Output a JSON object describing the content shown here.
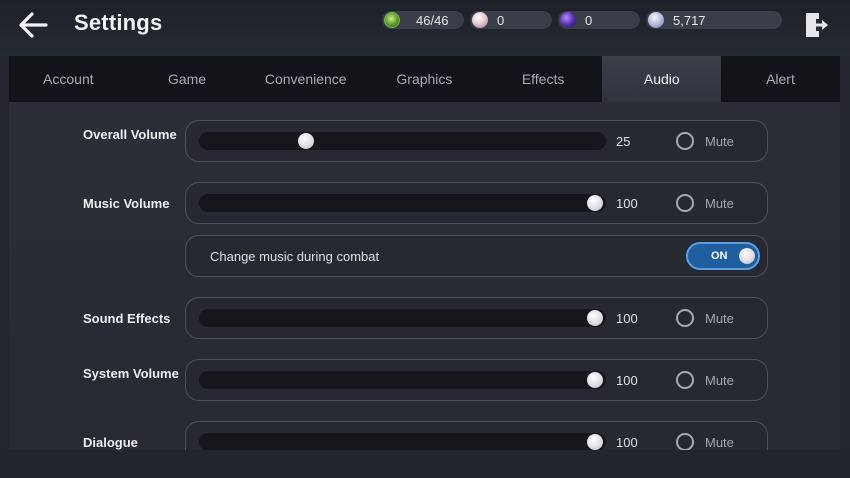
{
  "header": {
    "title": "Settings",
    "currencies": {
      "energy": "46/46",
      "pearl": "0",
      "orb": "0",
      "coin": "5,717"
    }
  },
  "tabs": [
    "Account",
    "Game",
    "Convenience",
    "Graphics",
    "Effects",
    "Audio",
    "Alert"
  ],
  "active_tab": "Audio",
  "audio": {
    "mute_label": "Mute",
    "overall": {
      "label": "Overall Volume",
      "value": 25
    },
    "music": {
      "label": "Music Volume",
      "value": 100
    },
    "combat_music": {
      "label": "Change music during combat",
      "state": "ON"
    },
    "sfx": {
      "label": "Sound Effects",
      "value": 100
    },
    "system": {
      "label": "System Volume",
      "value": 100
    },
    "dialogue": {
      "label": "Dialogue",
      "value": 100
    }
  },
  "colors": {
    "accent": "#1f5f9f",
    "background": "#23262f",
    "track": "#15171c"
  }
}
